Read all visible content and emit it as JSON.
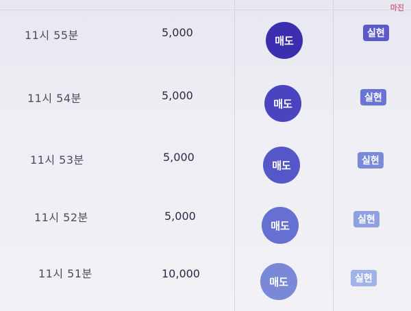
{
  "watermark": "마진",
  "rows": [
    {
      "time": "11시 55분",
      "amount": "5,000",
      "action": "매도",
      "status": "실현"
    },
    {
      "time": "11시 54분",
      "amount": "5,000",
      "action": "매도",
      "status": "실현"
    },
    {
      "time": "11시 53분",
      "amount": "5,000",
      "action": "매도",
      "status": "실현"
    },
    {
      "time": "11시 52분",
      "amount": "5,000",
      "action": "매도",
      "status": "실현"
    },
    {
      "time": "11시 51분",
      "amount": "10,000",
      "action": "매도",
      "status": "실현"
    }
  ],
  "colors": {
    "sell_button": [
      "#3b2fb0",
      "#4a44c0",
      "#5557c8",
      "#6670d0",
      "#7a88d8"
    ],
    "badge": [
      "#5b5ac8",
      "#6a74d2",
      "#7a8ad8",
      "#8ea0e0",
      "#a2b2e6"
    ]
  }
}
